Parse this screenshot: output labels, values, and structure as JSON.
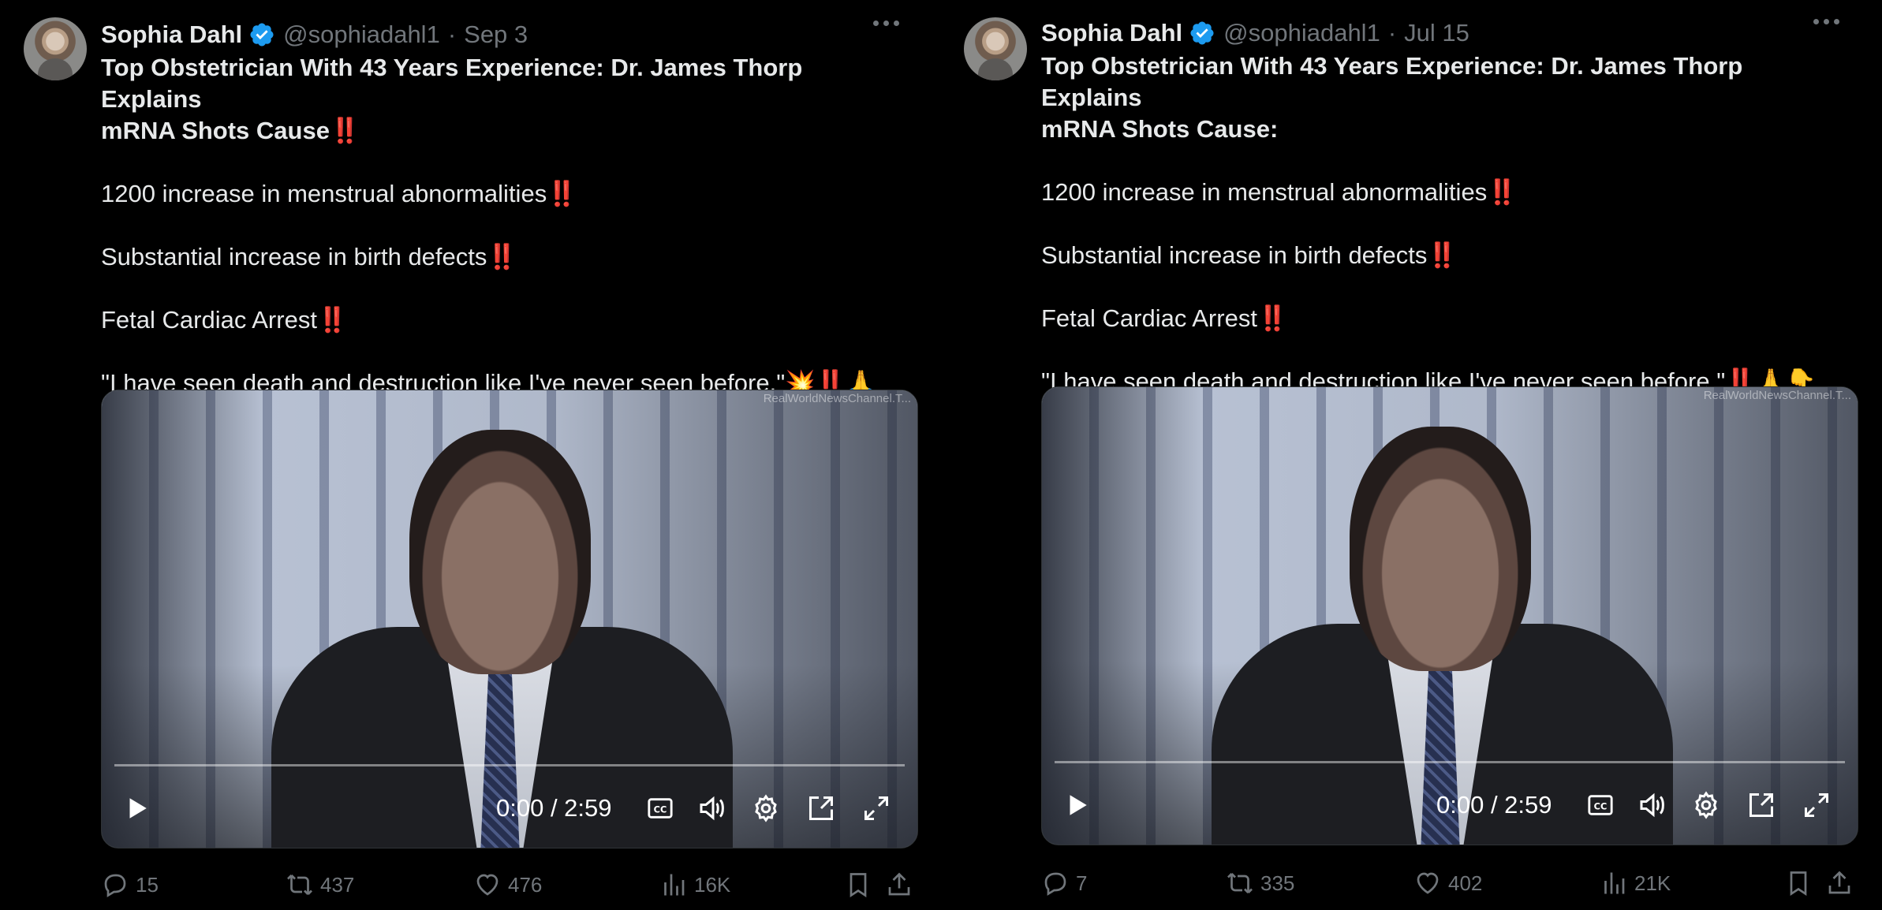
{
  "tweets": [
    {
      "name": "Sophia Dahl",
      "handle": "@sophiadahl1",
      "separator": "·",
      "date": "Sep 3",
      "title_line1": "Top Obstetrician With 43 Years Experience: Dr. James Thorp Explains",
      "title_line2": "mRNA Shots Cause",
      "title_suffix": "‼️",
      "line1": "1200 increase in menstrual abnormalities",
      "line2": "Substantial increase in birth defects",
      "line3": "Fetal Cardiac Arrest",
      "quote": "\"I have seen death and destruction like I've never seen before.\"",
      "quote_emojis": "💥‼️🙏👇",
      "bang": "‼️",
      "video": {
        "watermark": "RealWorldNewsChannel.T...",
        "time": "0:00 / 2:59",
        "progress": 0
      },
      "stats": {
        "replies": "15",
        "reposts": "437",
        "likes": "476",
        "views": "16K"
      }
    },
    {
      "name": "Sophia Dahl",
      "handle": "@sophiadahl1",
      "separator": "·",
      "date": "Jul 15",
      "title_line1": "Top Obstetrician With 43 Years Experience: Dr. James Thorp Explains",
      "title_line2": "mRNA Shots Cause:",
      "title_suffix": "",
      "line1": "1200 increase in menstrual abnormalities",
      "line2": "Substantial increase in birth defects",
      "line3": "Fetal Cardiac Arrest",
      "quote": "\"I have seen death and destruction like I've never seen before.\"",
      "quote_emojis": "‼️🙏👇",
      "bang": "‼️",
      "video": {
        "watermark": "RealWorldNewsChannel.T...",
        "time": "0:00 / 2:59",
        "progress": 0
      },
      "stats": {
        "replies": "7",
        "reposts": "335",
        "likes": "402",
        "views": "21K"
      }
    }
  ],
  "icons": {
    "verified": "verified-badge-icon",
    "more": "more-options-icon",
    "reply": "reply-icon",
    "repost": "repost-icon",
    "like": "like-icon",
    "views": "views-icon",
    "bookmark": "bookmark-icon",
    "share": "share-icon"
  },
  "colors": {
    "background": "#000000",
    "text": "#e7e9ea",
    "muted": "#71767b",
    "verified": "#1d9bf0",
    "emphasis": "#e0245e"
  }
}
